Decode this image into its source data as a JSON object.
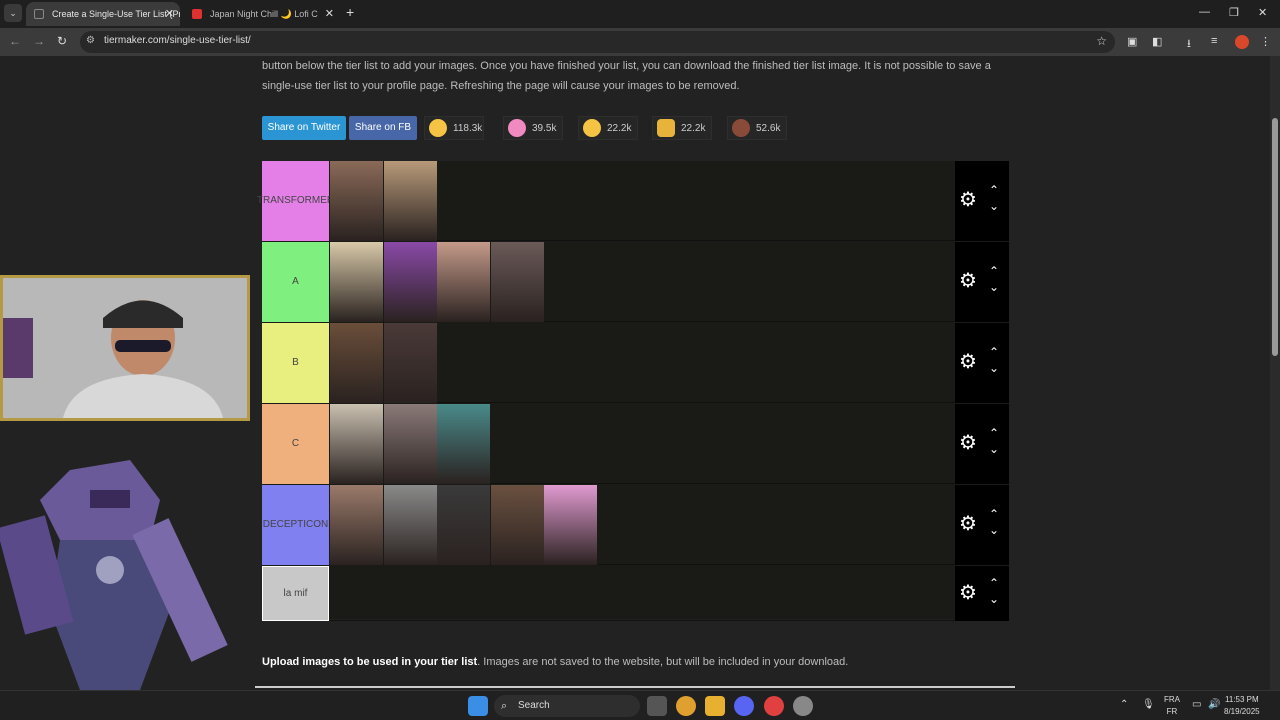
{
  "browser": {
    "tabs": [
      {
        "title": "Create a Single-Use Tier List (Pr",
        "active": true
      },
      {
        "title": "Japan Night Chill 🌙 Lofi C",
        "active": false
      }
    ],
    "url": "tiermaker.com/single-use-tier-list/"
  },
  "page": {
    "intro_line1": "button below the tier list to add your images. Once you have finished your list, you can download the finished tier list image. It is not possible to save a",
    "intro_line2": "single-use tier list to your profile page. Refreshing the page will cause your images to be removed.",
    "share_twitter": "Share on Twitter",
    "share_fb": "Share on FB",
    "reactions": [
      {
        "icon": "laugh-emoji-icon",
        "count": "118.3k"
      },
      {
        "icon": "heart-eyes-emoji-icon",
        "count": "39.5k"
      },
      {
        "icon": "grin-emoji-icon",
        "count": "22.2k"
      },
      {
        "icon": "clap-emoji-icon",
        "count": "22.2k"
      },
      {
        "icon": "poop-emoji-icon",
        "count": "52.6k"
      }
    ],
    "tiers": [
      {
        "label": "TRANSFORMER",
        "color": "#e47fe8",
        "item_count": 2,
        "item_colors": [
          "#8a6a58",
          "#b89a7a"
        ]
      },
      {
        "label": "A",
        "color": "#7ff07f",
        "item_count": 4,
        "item_colors": [
          "#d8c9a8",
          "#8a4aa8",
          "#c49a8a",
          "#6a5a58"
        ]
      },
      {
        "label": "B",
        "color": "#e9ef7e",
        "item_count": 2,
        "item_colors": [
          "#6a4e3a",
          "#4a3a38"
        ]
      },
      {
        "label": "C",
        "color": "#f0b07e",
        "item_count": 3,
        "item_colors": [
          "#c9c0b0",
          "#8a7a78",
          "#4a8a8a"
        ]
      },
      {
        "label": "DECEPTICON",
        "color": "#8080f0",
        "item_count": 5,
        "item_colors": [
          "#9a7a6a",
          "#8a8a8a",
          "#3a3a3a",
          "#6a5040",
          "#e09ad0"
        ]
      },
      {
        "label": "la mif",
        "color": "#c8c8c8",
        "item_count": 0,
        "item_colors": []
      }
    ],
    "upload_bold": "Upload images to be used in your tier list",
    "upload_rest": ". Images are not saved to the website, but will be included in your download."
  },
  "taskbar": {
    "search_label": "Search",
    "lang_top": "FRA",
    "lang_bottom": "FR",
    "time": "11:53 PM",
    "date": "8/19/2025"
  },
  "colors": {
    "twitter": "#2b94d3",
    "facebook": "#4767a9",
    "webcam_border": "#b49a45"
  }
}
